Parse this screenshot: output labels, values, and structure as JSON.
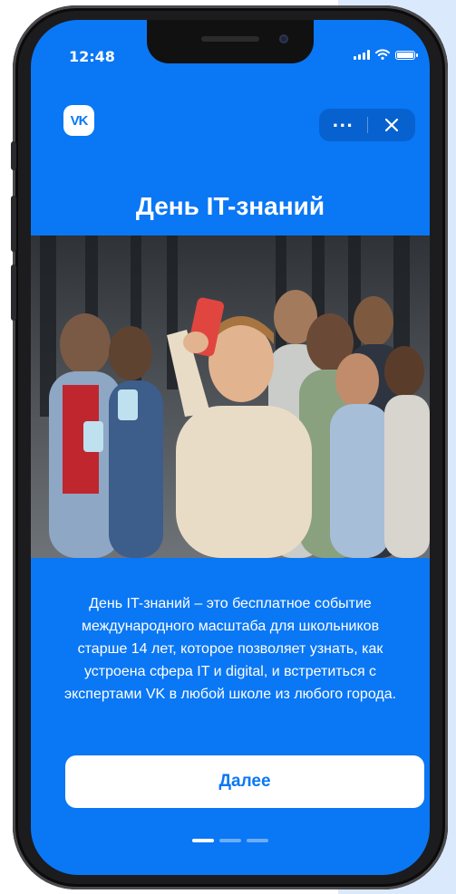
{
  "status_bar": {
    "time": "12:48"
  },
  "header": {
    "logo_text": "VK",
    "more_icon": "more-horizontal-icon",
    "close_icon": "close-icon"
  },
  "main": {
    "title": "День IT-знаний",
    "photo_icon": "group-selfie-photo",
    "description": "День IT-знаний – это бесплатное событие международного масштаба для школьников старше 14 лет, которое позволяет узнать, как устроена сфера IT и digital, и встретиться с экспертами VK в любой школе из любого города.",
    "next_button": "Далее"
  },
  "pager": {
    "current": 1,
    "total": 3
  },
  "colors": {
    "brand_blue": "#0a77f5",
    "white": "#ffffff"
  }
}
